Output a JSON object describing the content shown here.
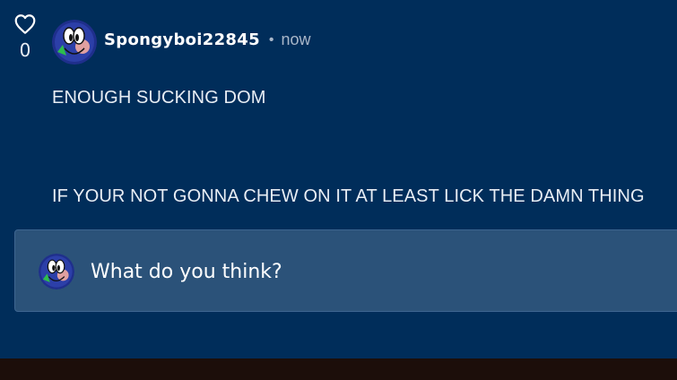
{
  "post": {
    "like_icon": "heart-outline-icon",
    "like_count": "0",
    "author": "Spongyboi22845",
    "separator": "•",
    "timestamp": "now",
    "avatar_icon": "cartoon-face-avatar"
  },
  "comment": {
    "lines": [
      "ENOUGH SUCKING DOM",
      "IF YOUR NOT GONNA CHEW ON IT AT LEAST LICK THE DAMN THING"
    ]
  },
  "reply": {
    "placeholder": "What do you think?",
    "value": ""
  },
  "colors": {
    "background": "#002d5a",
    "reply_box": "#2b5279",
    "text": "#ffffff",
    "muted": "#a9b7c9",
    "bottom_bar": "#1c0e0a"
  }
}
